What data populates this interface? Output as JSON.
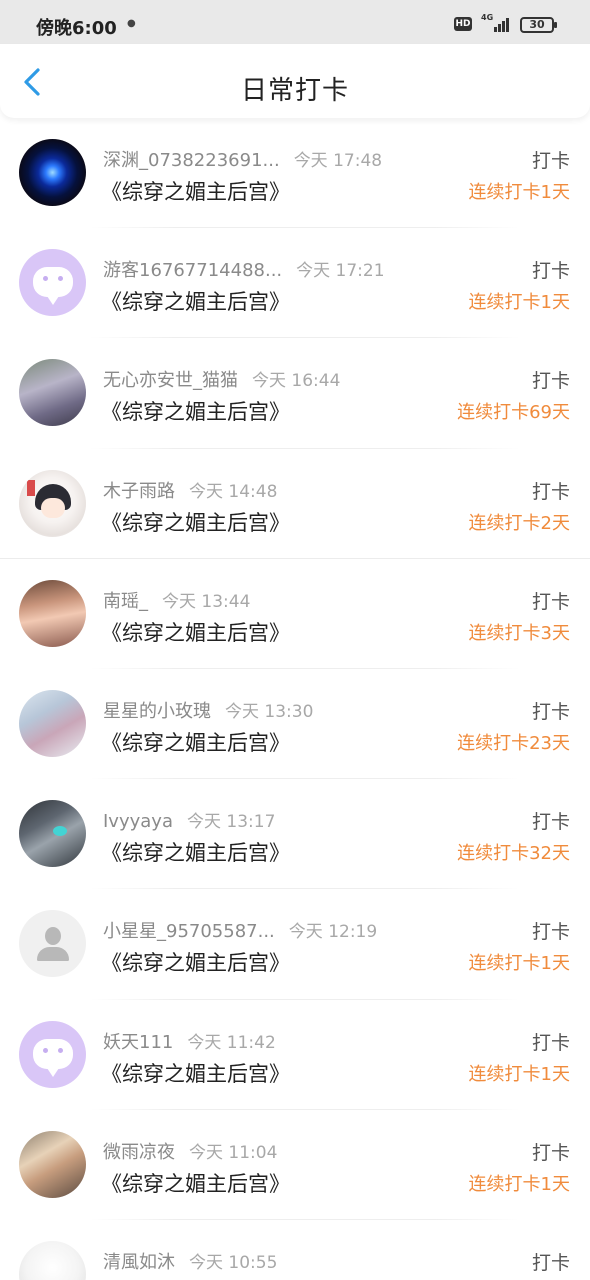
{
  "status_bar": {
    "time": "傍晚6:00",
    "hd_label": "HD",
    "network": "4G",
    "battery": "30",
    "icons": [
      "notification-icon",
      "hd-icon",
      "signal-icon",
      "battery-icon"
    ]
  },
  "header": {
    "title": "日常打卡",
    "back_icon": "chevron-left-icon"
  },
  "colors": {
    "accent": "#2f9be6",
    "streak": "#f08b3c",
    "avatar_bubble_bg": "#d9c6f7"
  },
  "items": [
    {
      "name": "深渊_0738223691...",
      "time": "今天 17:48",
      "book": "《综穿之媚主后宫》",
      "action": "打卡",
      "streak": "连续打卡1天",
      "avatar": "photo-avatar"
    },
    {
      "name": "游客16767714488...",
      "time": "今天 17:21",
      "book": "《综穿之媚主后宫》",
      "action": "打卡",
      "streak": "连续打卡1天",
      "avatar": "chat-bubble-avatar"
    },
    {
      "name": "无心亦安世_猫猫",
      "time": "今天 16:44",
      "book": "《综穿之媚主后宫》",
      "action": "打卡",
      "streak": "连续打卡69天",
      "avatar": "photo-avatar"
    },
    {
      "name": "木子雨路",
      "time": "今天 14:48",
      "book": "《综穿之媚主后宫》",
      "action": "打卡",
      "streak": "连续打卡2天",
      "avatar": "illustration-avatar"
    },
    {
      "name": "南瑶_",
      "time": "今天 13:44",
      "book": "《综穿之媚主后宫》",
      "action": "打卡",
      "streak": "连续打卡3天",
      "avatar": "photo-avatar"
    },
    {
      "name": "星星的小玫瑰",
      "time": "今天 13:30",
      "book": "《综穿之媚主后宫》",
      "action": "打卡",
      "streak": "连续打卡23天",
      "avatar": "photo-avatar"
    },
    {
      "name": "Ivyyaya",
      "time": "今天 13:17",
      "book": "《综穿之媚主后宫》",
      "action": "打卡",
      "streak": "连续打卡32天",
      "avatar": "photo-avatar"
    },
    {
      "name": "小星星_95705587...",
      "time": "今天 12:19",
      "book": "《综穿之媚主后宫》",
      "action": "打卡",
      "streak": "连续打卡1天",
      "avatar": "default-user-avatar"
    },
    {
      "name": "妖天111",
      "time": "今天 11:42",
      "book": "《综穿之媚主后宫》",
      "action": "打卡",
      "streak": "连续打卡1天",
      "avatar": "chat-bubble-avatar"
    },
    {
      "name": "微雨凉夜",
      "time": "今天 11:04",
      "book": "《综穿之媚主后宫》",
      "action": "打卡",
      "streak": "连续打卡1天",
      "avatar": "photo-avatar"
    },
    {
      "name": "清風如沐",
      "time": "今天 10:55",
      "book": "",
      "action": "打卡",
      "streak": "",
      "avatar": "photo-avatar"
    }
  ]
}
